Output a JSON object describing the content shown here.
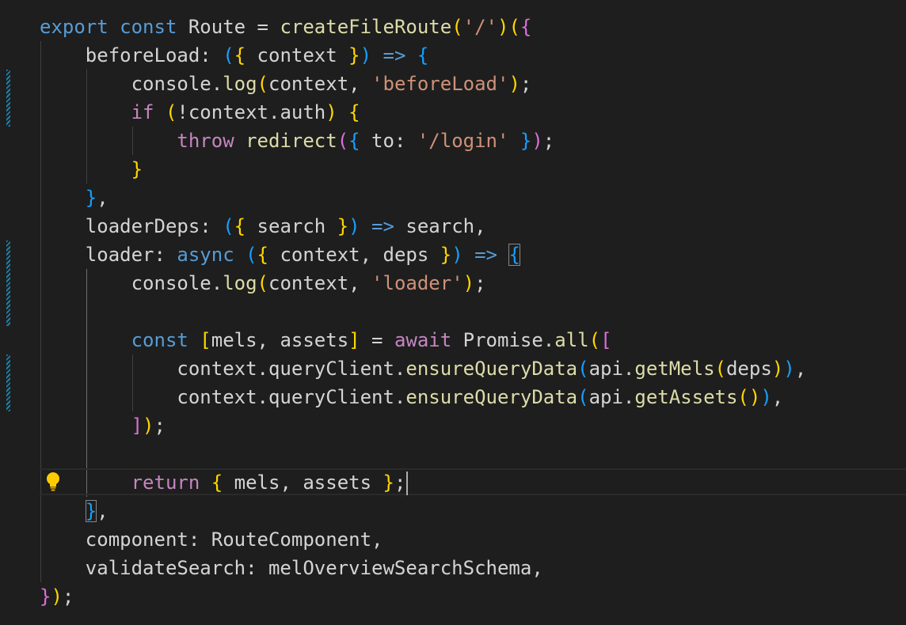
{
  "editor": {
    "lines": [
      [
        [
          "kw",
          "export"
        ],
        [
          "t",
          " "
        ],
        [
          "kw",
          "const"
        ],
        [
          "t",
          " Route = "
        ],
        [
          "fn",
          "createFileRoute"
        ],
        [
          "p1",
          "("
        ],
        [
          "str",
          "'/'"
        ],
        [
          "p1",
          ")"
        ],
        [
          "p1",
          "("
        ],
        [
          "p2",
          "{"
        ]
      ],
      [
        [
          "t",
          "    beforeLoad: "
        ],
        [
          "p3",
          "("
        ],
        [
          "p1",
          "{"
        ],
        [
          "t",
          " context "
        ],
        [
          "p1",
          "}"
        ],
        [
          "p3",
          ")"
        ],
        [
          "t",
          " "
        ],
        [
          "kw",
          "=>"
        ],
        [
          "t",
          " "
        ],
        [
          "p3",
          "{"
        ]
      ],
      [
        [
          "t",
          "        console."
        ],
        [
          "fn",
          "log"
        ],
        [
          "p1",
          "("
        ],
        [
          "t",
          "context, "
        ],
        [
          "str",
          "'beforeLoad'"
        ],
        [
          "p1",
          ")"
        ],
        [
          "t",
          ";"
        ]
      ],
      [
        [
          "t",
          "        "
        ],
        [
          "ctl",
          "if"
        ],
        [
          "t",
          " "
        ],
        [
          "p1",
          "("
        ],
        [
          "t",
          "!context.auth"
        ],
        [
          "p1",
          ")"
        ],
        [
          "t",
          " "
        ],
        [
          "p1",
          "{"
        ]
      ],
      [
        [
          "t",
          "            "
        ],
        [
          "ctl",
          "throw"
        ],
        [
          "t",
          " "
        ],
        [
          "fn",
          "redirect"
        ],
        [
          "p2",
          "("
        ],
        [
          "p3",
          "{"
        ],
        [
          "t",
          " to: "
        ],
        [
          "str",
          "'/login'"
        ],
        [
          "t",
          " "
        ],
        [
          "p3",
          "}"
        ],
        [
          "p2",
          ")"
        ],
        [
          "t",
          ";"
        ]
      ],
      [
        [
          "t",
          "        "
        ],
        [
          "p1",
          "}"
        ]
      ],
      [
        [
          "t",
          "    "
        ],
        [
          "p3",
          "}"
        ],
        [
          "t",
          ","
        ]
      ],
      [
        [
          "t",
          "    loaderDeps: "
        ],
        [
          "p3",
          "("
        ],
        [
          "p1",
          "{"
        ],
        [
          "t",
          " search "
        ],
        [
          "p1",
          "}"
        ],
        [
          "p3",
          ")"
        ],
        [
          "t",
          " "
        ],
        [
          "kw",
          "=>"
        ],
        [
          "t",
          " search,"
        ]
      ],
      [
        [
          "t",
          "    loader: "
        ],
        [
          "kw",
          "async"
        ],
        [
          "t",
          " "
        ],
        [
          "p3",
          "("
        ],
        [
          "p1",
          "{"
        ],
        [
          "t",
          " context, deps "
        ],
        [
          "p1",
          "}"
        ],
        [
          "p3",
          ")"
        ],
        [
          "t",
          " "
        ],
        [
          "kw",
          "=>"
        ],
        [
          "t",
          " "
        ],
        [
          "p3 bm",
          "{"
        ]
      ],
      [
        [
          "t",
          "        console."
        ],
        [
          "fn",
          "log"
        ],
        [
          "p1",
          "("
        ],
        [
          "t",
          "context, "
        ],
        [
          "str",
          "'loader'"
        ],
        [
          "p1",
          ")"
        ],
        [
          "t",
          ";"
        ]
      ],
      [
        [
          "t",
          ""
        ]
      ],
      [
        [
          "t",
          "        "
        ],
        [
          "kw",
          "const"
        ],
        [
          "t",
          " "
        ],
        [
          "p1",
          "["
        ],
        [
          "t",
          "mels, assets"
        ],
        [
          "p1",
          "]"
        ],
        [
          "t",
          " = "
        ],
        [
          "ctl",
          "await"
        ],
        [
          "t",
          " Promise."
        ],
        [
          "fn",
          "all"
        ],
        [
          "p1",
          "("
        ],
        [
          "p2",
          "["
        ]
      ],
      [
        [
          "t",
          "            context.queryClient."
        ],
        [
          "fn",
          "ensureQueryData"
        ],
        [
          "p3",
          "("
        ],
        [
          "t",
          "api."
        ],
        [
          "fn",
          "getMels"
        ],
        [
          "p1",
          "("
        ],
        [
          "t",
          "deps"
        ],
        [
          "p1",
          ")"
        ],
        [
          "p3",
          ")"
        ],
        [
          "t",
          ","
        ]
      ],
      [
        [
          "t",
          "            context.queryClient."
        ],
        [
          "fn",
          "ensureQueryData"
        ],
        [
          "p3",
          "("
        ],
        [
          "t",
          "api."
        ],
        [
          "fn",
          "getAssets"
        ],
        [
          "p1",
          "("
        ],
        [
          "p1",
          ")"
        ],
        [
          "p3",
          ")"
        ],
        [
          "t",
          ","
        ]
      ],
      [
        [
          "t",
          "        "
        ],
        [
          "p2",
          "]"
        ],
        [
          "p1",
          ")"
        ],
        [
          "t",
          ";"
        ]
      ],
      [
        [
          "t",
          ""
        ]
      ],
      [
        [
          "t",
          "        "
        ],
        [
          "ctl",
          "return"
        ],
        [
          "t",
          " "
        ],
        [
          "p1",
          "{"
        ],
        [
          "t",
          " mels, assets "
        ],
        [
          "p1",
          "}"
        ],
        [
          "t",
          ";"
        ]
      ],
      [
        [
          "t",
          "    "
        ],
        [
          "p3 bm",
          "}"
        ],
        [
          "t",
          ","
        ]
      ],
      [
        [
          "t",
          "    component: RouteComponent,"
        ]
      ],
      [
        [
          "t",
          "    validateSearch: melOverviewSearchSchema,"
        ]
      ],
      [
        [
          "p2",
          "}"
        ],
        [
          "p1",
          ")"
        ],
        [
          "t",
          ";"
        ]
      ]
    ]
  }
}
